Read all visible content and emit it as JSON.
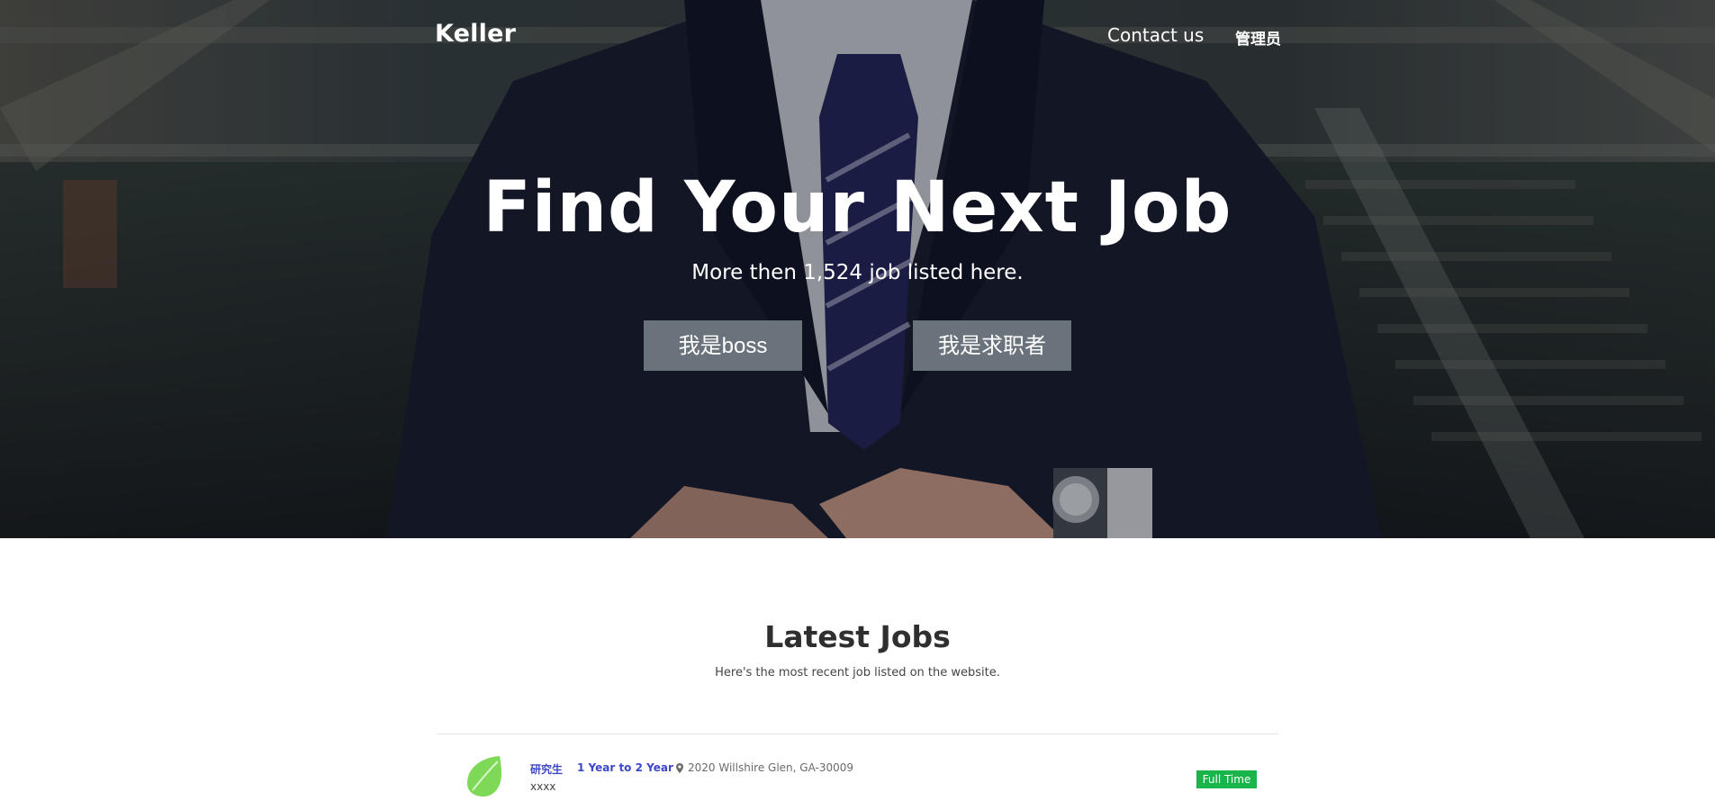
{
  "colors": {
    "accent": "#3d47c9",
    "button_bg": "#6a727c",
    "badge_green": "#19b54a",
    "logo_green": "#7ed957"
  },
  "nav": {
    "brand": "Keller",
    "links": [
      {
        "label": "Contact us"
      },
      {
        "label": "管理员"
      }
    ]
  },
  "hero": {
    "title": "Find Your Next Job",
    "subtitle": "More then 1,524 job listed here.",
    "buttons": [
      {
        "label": "我是boss"
      },
      {
        "label": "我是求职者"
      }
    ]
  },
  "latest": {
    "title": "Latest Jobs",
    "subtitle": "Here's the most recent job listed on the website.",
    "jobs": [
      {
        "title": "研究生",
        "experience": "1 Year to 2 Year",
        "location": "2020 Willshire Glen, GA-30009",
        "description": "xxxx",
        "type": "Full Time",
        "logo_icon": "leaf-icon",
        "location_icon": "map-pin-icon"
      }
    ]
  }
}
